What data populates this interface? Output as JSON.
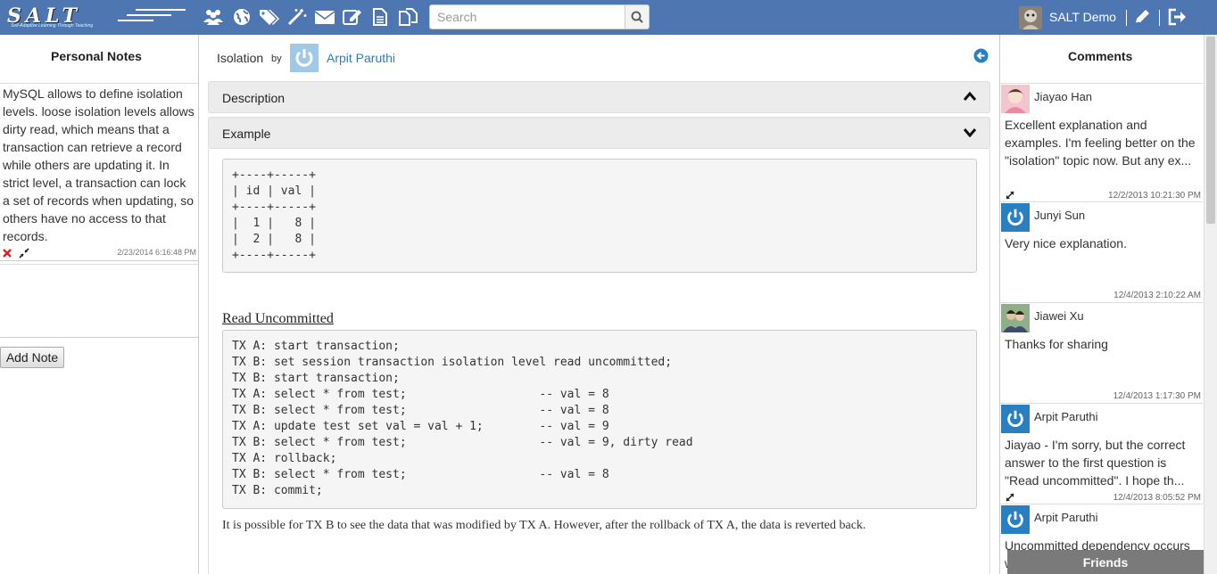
{
  "nav": {
    "logo_text": "SALT",
    "logo_tagline": "Self-Adaptive Learning Through Teaching",
    "icons": [
      "users-icon",
      "globe-icon",
      "tags-icon",
      "magic-wand-icon",
      "envelope-icon",
      "edit-icon",
      "document-icon",
      "copy-icon"
    ],
    "search_placeholder": "Search",
    "user_name": "SALT Demo"
  },
  "notes": {
    "title": "Personal Notes",
    "note_text": "MySQL allows to define isolation levels. loose isolation levels allows dirty read, which means that a transaction can retrieve a record while others are updating it. In strict level, a transaction can lock a set of records when updating, so others have no access to that records.",
    "note_date": "2/23/2014 6:16:48 PM",
    "add_label": "Add Note"
  },
  "topic": {
    "title": "Isolation",
    "by": "by",
    "author": "Arpit Paruthi",
    "sections": [
      "Description",
      "Example"
    ],
    "table_code": "+----+-----+\n| id | val |\n+----+-----+\n|  1 |   8 |\n|  2 |   8 |\n+----+-----+",
    "heading": "Read Uncommitted",
    "tx_code": "TX A: start transaction;\nTX B: set session transaction isolation level read uncommitted;\nTX B: start transaction;\nTX A: select * from test;                   -- val = 8\nTX B: select * from test;                   -- val = 8\nTX A: update test set val = val + 1;        -- val = 9\nTX B: select * from test;                   -- val = 9, dirty read\nTX A: rollback;\nTX B: select * from test;                   -- val = 8\nTX B: commit;",
    "paragraph": "It is possible for TX B to see the data that was modified by TX A. However, after the rollback of TX A, the data is reverted back."
  },
  "comments": {
    "title": "Comments",
    "items": [
      {
        "name": "Jiayao Han",
        "text": "Excellent explanation and examples. I'm feeling better on the \"isolation\" topic now. But any ex...",
        "date": "12/2/2013 10:21:30 PM"
      },
      {
        "name": "Junyi Sun",
        "text": "Very nice explanation.",
        "date": "12/4/2013 2:10:22 AM"
      },
      {
        "name": "Jiawei Xu",
        "text": "Thanks for sharing",
        "date": "12/4/2013 1:17:30 PM"
      },
      {
        "name": "Arpit Paruthi",
        "text": "Jiayao - I'm sorry, but the correct answer to the first question is \"Read uncommitted\". I hope th...",
        "date": "12/4/2013 8:05:52 PM"
      },
      {
        "name": "Arpit Paruthi",
        "text": "Uncommitted dependency occurs w...",
        "date": ""
      }
    ]
  },
  "friends_label": "Friends"
}
